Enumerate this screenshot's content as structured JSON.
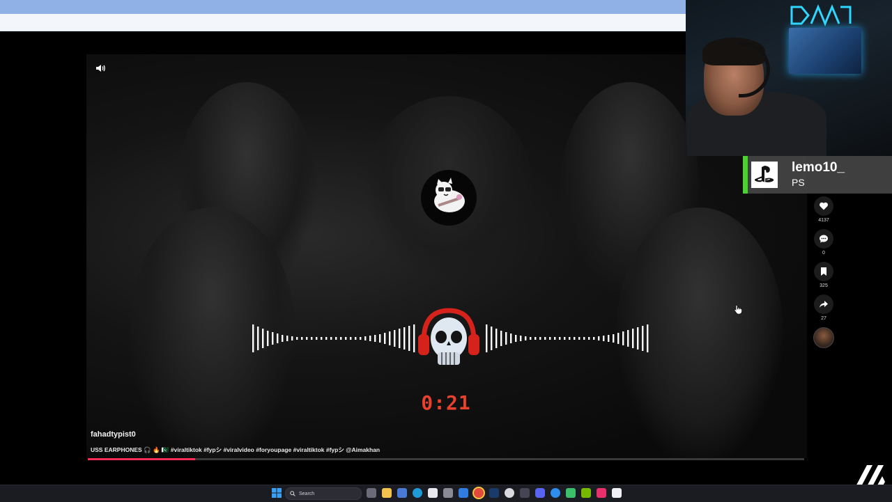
{
  "video": {
    "author": "fahadtypist0",
    "caption": "USS EARPHONES 🎧 🔥 🇵🇰 #viraltiktok #fypシ #viralvideo #foryoupage #viraltiktok #fypシ @Aimakhan",
    "timer": "0:21",
    "progress": 0.15
  },
  "actions": {
    "likes": "4137",
    "comments": "0",
    "saves": "325",
    "shares": "27"
  },
  "overlay": {
    "name": "lemo10_",
    "platform": "PS"
  },
  "taskbar": {
    "search_label": "Search"
  },
  "colors": {
    "accent_red": "#fe2c55",
    "timer_red": "#e8412c",
    "overlay_green": "#49d32d",
    "neon_cyan": "#2fd6ff"
  }
}
